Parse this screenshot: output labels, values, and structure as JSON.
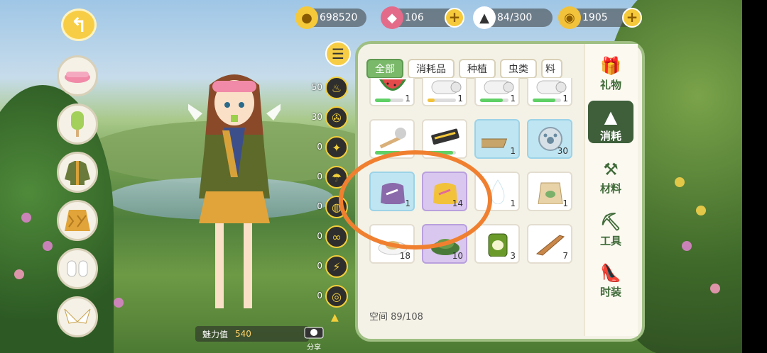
{
  "currency": {
    "coins": "698520",
    "gems": "106",
    "rice": "84/300",
    "yarn": "1905"
  },
  "character": {
    "charm_label": "魅力值",
    "charm_value": "540"
  },
  "camera_label": "分享",
  "skills": [
    {
      "count": "50",
      "icon": "fire-icon"
    },
    {
      "count": "30",
      "icon": "fan-icon"
    },
    {
      "count": "0",
      "icon": "flashlight-icon"
    },
    {
      "count": "0",
      "icon": "umbrella-icon"
    },
    {
      "count": "0",
      "icon": "bug-net-icon"
    },
    {
      "count": "0",
      "icon": "binoculars-icon"
    },
    {
      "count": "0",
      "icon": "lightning-icon"
    },
    {
      "count": "0",
      "icon": "gas-mask-icon"
    }
  ],
  "tabs": [
    "全部",
    "消耗品",
    "种植",
    "虫类",
    "料"
  ],
  "active_tab": "全部",
  "items": [
    {
      "name": "watermelon",
      "count": "1",
      "bg": "white",
      "bar": 0.55
    },
    {
      "name": "bandage-roll",
      "count": "1",
      "bg": "white",
      "bar": 0.25
    },
    {
      "name": "bandage-roll",
      "count": "1",
      "bg": "white",
      "bar": 0.8
    },
    {
      "name": "bandage-roll",
      "count": "1",
      "bg": "white",
      "bar": 0.8
    },
    {
      "name": "mop",
      "count": "",
      "bg": "white",
      "bar": 0.9
    },
    {
      "name": "harmonica",
      "count": "",
      "bg": "white",
      "bar": 0.9
    },
    {
      "name": "wood-plank",
      "count": "1",
      "bg": "blue",
      "bar": null
    },
    {
      "name": "paw-coin",
      "count": "30",
      "bg": "blue",
      "bar": null
    },
    {
      "name": "purple-pouch",
      "count": "1",
      "bg": "blue",
      "bar": null
    },
    {
      "name": "yellow-pouch",
      "count": "14",
      "bg": "purple",
      "bar": null
    },
    {
      "name": "water-drop",
      "count": "1",
      "bg": "white",
      "bar": null
    },
    {
      "name": "seed-bag",
      "count": "1",
      "bg": "white",
      "bar": null
    },
    {
      "name": "food-plate",
      "count": "18",
      "bg": "white",
      "bar": null
    },
    {
      "name": "herb-pile",
      "count": "10",
      "bg": "purple",
      "bar": null
    },
    {
      "name": "pet-food-can",
      "count": "3",
      "bg": "white",
      "bar": null
    },
    {
      "name": "dried-fish",
      "count": "7",
      "bg": "white",
      "bar": null
    }
  ],
  "space": "空间  89/108",
  "side_categories": [
    {
      "label": "礼物",
      "icon": "gift-icon"
    },
    {
      "label": "消耗",
      "icon": "rice-ball-icon"
    },
    {
      "label": "材料",
      "icon": "material-icon"
    },
    {
      "label": "工具",
      "icon": "shovel-icon"
    },
    {
      "label": "时装",
      "icon": "high-heel-icon"
    }
  ],
  "active_side": "消耗",
  "colors": {
    "accent": "#7ab86a",
    "panel_border": "#9fbf83",
    "highlight_circle": "#f08030"
  }
}
